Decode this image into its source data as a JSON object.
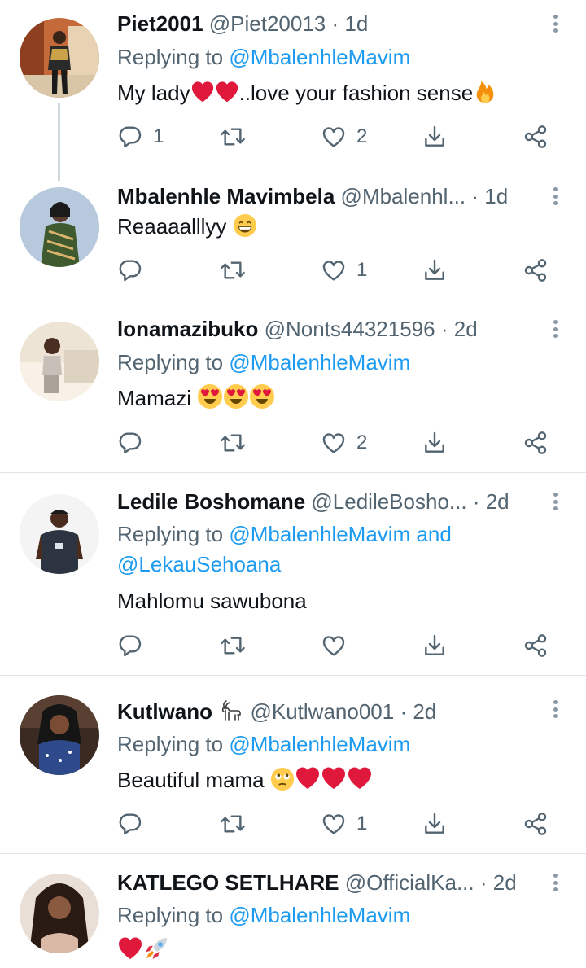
{
  "tweets": [
    {
      "name": "Piet2001",
      "handle": "@Piet20013",
      "time": "1d",
      "replying_prefix": "Replying to ",
      "replying_to": "@MbalenhleMavim",
      "text": "My lady",
      "text_suffix": "..love your fashion sense",
      "emojis": [
        "red-heart",
        "red-heart",
        "fire"
      ],
      "replies": "1",
      "retweets": "",
      "likes": "2"
    },
    {
      "name": "Mbalenhle Mavimbela",
      "handle": "@Mbalenhl...",
      "time": "1d",
      "text": "Reaaaalllyy",
      "emojis": [
        "grinning-face"
      ],
      "replies": "",
      "retweets": "",
      "likes": "1"
    },
    {
      "name": "lonamazibuko",
      "handle": "@Nonts44321596",
      "time": "2d",
      "replying_prefix": "Replying to ",
      "replying_to": "@MbalenhleMavim",
      "text": "Mamazi",
      "emojis": [
        "heart-eyes",
        "heart-eyes",
        "heart-eyes"
      ],
      "replies": "",
      "retweets": "",
      "likes": "2"
    },
    {
      "name": "Ledile Boshomane",
      "handle": "@LedileBosho...",
      "time": "2d",
      "replying_prefix": "Replying to ",
      "replying_to": "@MbalenhleMavim",
      "replying_join": " and",
      "replying_to_2": "@LekauSehoana",
      "text": "Mahlomu sawubona",
      "replies": "",
      "retweets": "",
      "likes": ""
    },
    {
      "name": "Kutlwano",
      "name_emoji": "goat",
      "handle": "@Kutlwano001",
      "time": "2d",
      "replying_prefix": "Replying to ",
      "replying_to": "@MbalenhleMavim",
      "text": "Beautiful mama",
      "emojis": [
        "rolling-eyes",
        "red-heart",
        "red-heart",
        "red-heart"
      ],
      "replies": "",
      "retweets": "",
      "likes": "1"
    },
    {
      "name": "KATLEGO SETLHARE",
      "handle": "@OfficialKa...",
      "time": "2d",
      "replying_prefix": "Replying to ",
      "replying_to": "@MbalenhleMavim",
      "emojis": [
        "red-heart",
        "rocket"
      ]
    }
  ],
  "separator": "·",
  "icons": {
    "reply": "reply-icon",
    "retweet": "retweet-icon",
    "like": "heart-outline-icon",
    "bookmark": "download-arrow-icon",
    "share": "share-icon",
    "more": "more-vertical-icon"
  },
  "colors": {
    "mention": "#1d9bf0",
    "secondary": "#536471",
    "divider": "#e1e5e8",
    "heart_emoji": "#e0193c"
  }
}
